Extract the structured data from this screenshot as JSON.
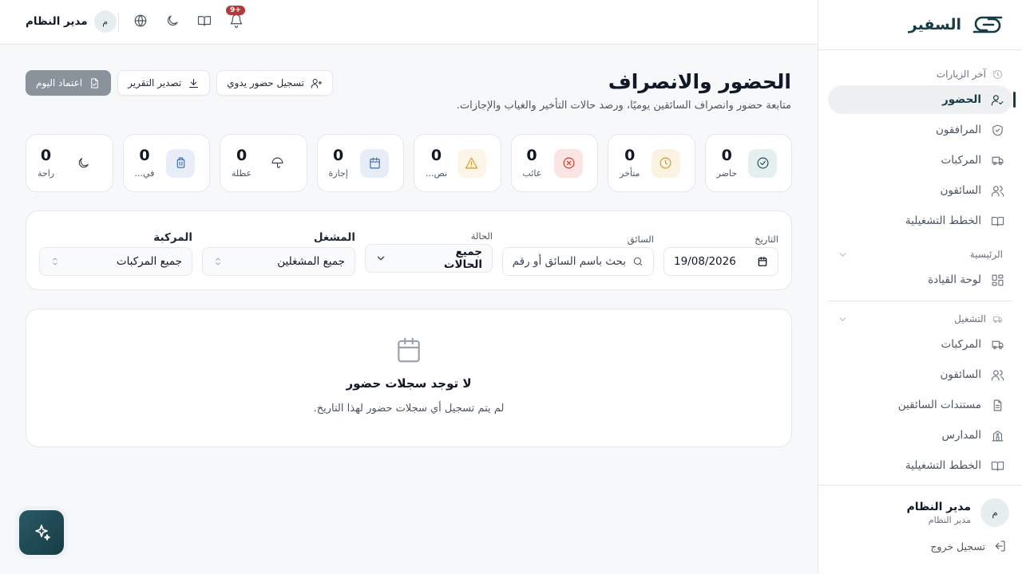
{
  "brand": {
    "name": "السفير"
  },
  "topbar": {
    "user_initial": "م",
    "user_name": "مدير النظام",
    "notifications_badge": "9+"
  },
  "sidebar": {
    "recent_label": "آخر الزيارات",
    "recent_items": [
      {
        "label": "الحضور",
        "icon": "user-check-icon",
        "active": true
      },
      {
        "label": "المرافقون",
        "icon": "shield-icon"
      },
      {
        "label": "المركبات",
        "icon": "bus-icon"
      },
      {
        "label": "السائقون",
        "icon": "users-icon"
      },
      {
        "label": "الخطط التشغيلية",
        "icon": "book-icon"
      }
    ],
    "main_label": "الرئيسية",
    "main_items": [
      {
        "label": "لوحة القيادة",
        "icon": "dashboard-icon"
      }
    ],
    "ops_label": "التشغيل",
    "ops_items": [
      {
        "label": "المركبات",
        "icon": "bus-icon"
      },
      {
        "label": "السائقون",
        "icon": "users-icon"
      },
      {
        "label": "مستندات السائقين",
        "icon": "file-icon"
      },
      {
        "label": "المدارس",
        "icon": "school-icon"
      },
      {
        "label": "الخطط التشغيلية",
        "icon": "book-icon"
      }
    ],
    "footer": {
      "user_initial": "م",
      "user_name": "مدير النظام",
      "user_role": "مدير النظام",
      "logout_label": "تسجيل خروج"
    }
  },
  "page": {
    "title": "الحضور والانصراف",
    "subtitle": "متابعة حضور وانصراف السائقين يوميًا، ورصد حالات التأخير والغياب والإجازات.",
    "actions": {
      "manual": "تسجيل حضور يدوي",
      "export": "تصدير التقرير",
      "approve": "اعتماد اليوم"
    }
  },
  "stats": [
    {
      "label": "حاضر",
      "value": "0",
      "icon": "check-circle-icon",
      "bg": "#e4efee",
      "fg": "#1f4d55"
    },
    {
      "label": "متأخر",
      "value": "0",
      "icon": "clock-icon",
      "bg": "#fbf3e1",
      "fg": "#c99a2e"
    },
    {
      "label": "غائب",
      "value": "0",
      "icon": "x-circle-icon",
      "bg": "#fbe4e4",
      "fg": "#c0392b"
    },
    {
      "label": "نص...",
      "value": "0",
      "icon": "warning-icon",
      "bg": "#fdf5e7",
      "fg": "#d4952a"
    },
    {
      "label": "إجازة",
      "value": "0",
      "icon": "calendar-icon",
      "bg": "#e6edf7",
      "fg": "#3d6aa8"
    },
    {
      "label": "عطلة",
      "value": "0",
      "icon": "umbrella-icon",
      "bg": "#ffffff",
      "fg": "#374151"
    },
    {
      "label": "في...",
      "value": "0",
      "icon": "luggage-icon",
      "bg": "#e8eef8",
      "fg": "#3d6aa8"
    },
    {
      "label": "راحة",
      "value": "0",
      "icon": "moon-icon",
      "bg": "#ffffff",
      "fg": "#374151"
    }
  ],
  "filters": {
    "date_label": "التاريخ",
    "date_value": "19/08/2026",
    "driver_label": "السائق",
    "driver_placeholder": "بحث باسم السائق أو رقم",
    "status_label": "الحالة",
    "status_value": "جميع الحالات",
    "operator_label": "المشغل",
    "operator_value": "جميع المشغلين",
    "vehicle_label": "المركبة",
    "vehicle_value": "جميع المركبات"
  },
  "empty_state": {
    "title": "لا توجد سجلات حضور",
    "message": "لم يتم تسجيل أي سجلات حضور لهذا التاريخ."
  }
}
